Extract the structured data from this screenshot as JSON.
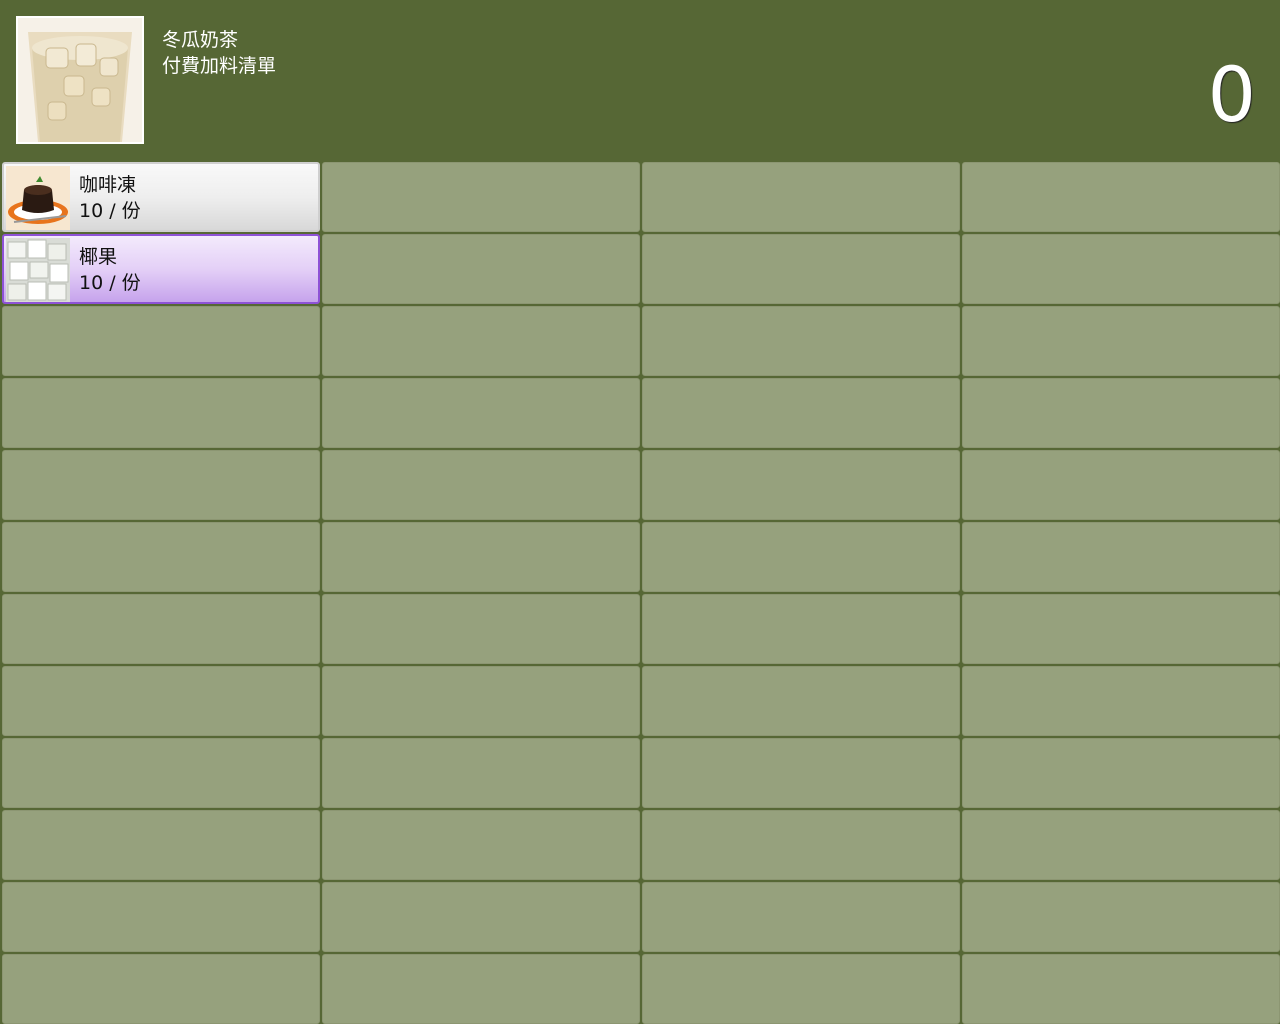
{
  "header": {
    "product_name": "冬瓜奶茶",
    "list_title": "付費加料清單",
    "count": "0"
  },
  "items": [
    {
      "name": "咖啡凍",
      "price": "10 / 份",
      "icon": "coffee-jelly-photo",
      "selected": false
    },
    {
      "name": "椰果",
      "price": "10 / 份",
      "icon": "nata-de-coco-photo",
      "selected": true
    }
  ],
  "grid": {
    "columns": 4,
    "rows": 12
  },
  "colors": {
    "background": "#566735",
    "empty_cell": "#96a17d",
    "selected_border": "#8e52d6"
  }
}
